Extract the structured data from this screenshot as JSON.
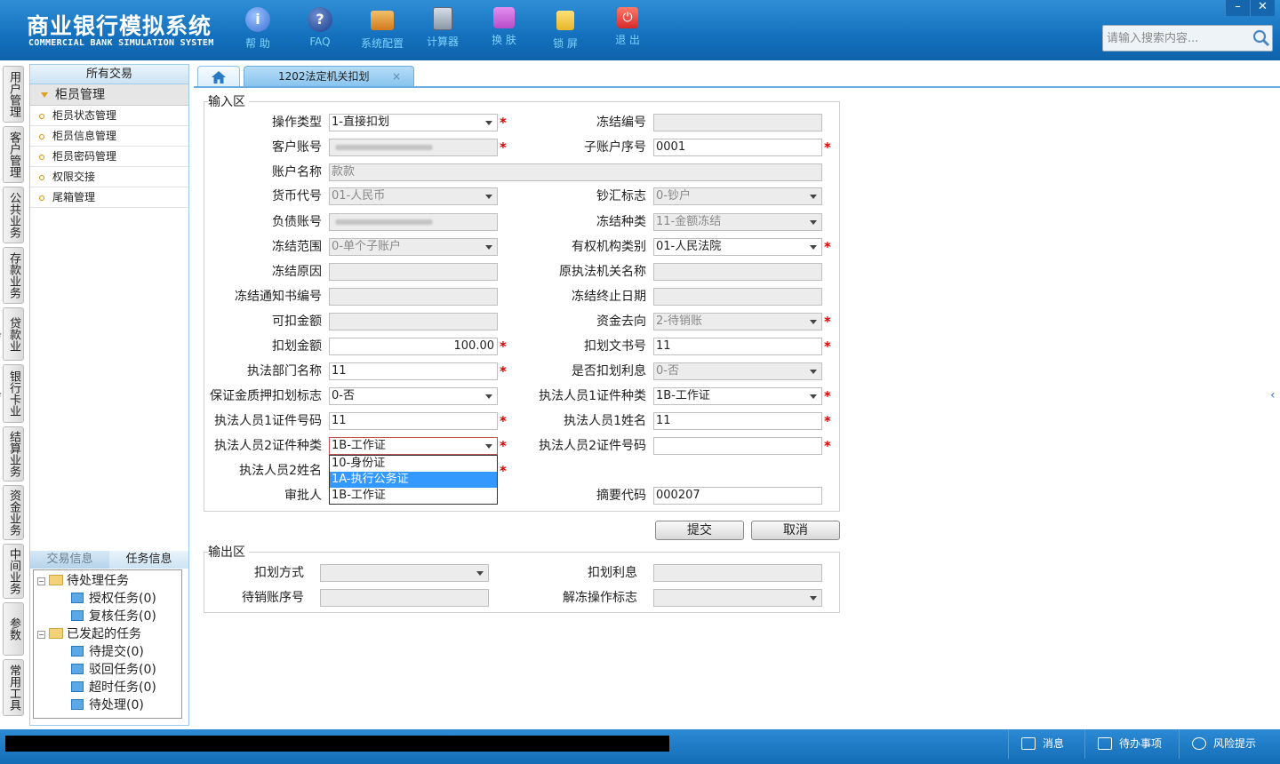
{
  "header": {
    "brand_cn": "商业银行模拟系统",
    "brand_en": "COMMERCIAL BANK SIMULATION SYSTEM",
    "toolbar": [
      {
        "label": "帮 助",
        "icon": "info-icon",
        "color": "#3a6fd1"
      },
      {
        "label": "FAQ",
        "icon": "question-icon",
        "color": "#1a3e8c"
      },
      {
        "label": "系统配置",
        "icon": "toolbox-icon",
        "color": "#e08a2a"
      },
      {
        "label": "计算器",
        "icon": "calculator-icon",
        "color": "#8a98a8"
      },
      {
        "label": "换 肤",
        "icon": "shirt-icon",
        "color": "#b84cc9"
      },
      {
        "label": "锁 屏",
        "icon": "lock-icon",
        "color": "#e8b52a"
      },
      {
        "label": "退 出",
        "icon": "power-icon",
        "color": "#d62a2a"
      }
    ],
    "window_buttons": [
      "–",
      "✕"
    ],
    "search_placeholder": "请输入搜索内容..."
  },
  "side_tabs": [
    "用户管理",
    "客户管理",
    "公共业务",
    "存款业务",
    "贷款业务",
    "银行卡业务",
    "结算业务",
    "资金业务",
    "中间业务",
    "参数",
    "常用工具"
  ],
  "nav": {
    "header": "所有交易",
    "group": "柜员管理",
    "items": [
      "柜员状态管理",
      "柜员信息管理",
      "柜员密码管理",
      "权限交接",
      "尾箱管理"
    ]
  },
  "task_panel": {
    "tabs": [
      "交易信息",
      "任务信息"
    ],
    "tree": {
      "pending": "待处理任务",
      "pending_children": [
        "授权任务(0)",
        "复核任务(0)"
      ],
      "initiated": "已发起的任务",
      "initiated_children": [
        "待提交(0)",
        "驳回任务(0)",
        "超时任务(0)",
        "待处理(0)"
      ]
    }
  },
  "doc_tab": {
    "title": "1202法定机关扣划",
    "close": "×"
  },
  "input_section": {
    "title": "输入区",
    "fields": {
      "op_type": {
        "label": "操作类型",
        "value": "1-直接扣划"
      },
      "freeze_no": {
        "label": "冻结编号",
        "value": ""
      },
      "cust_account": {
        "label": "客户账号",
        "value": ""
      },
      "sub_account_seq": {
        "label": "子账户序号",
        "value": "0001"
      },
      "account_name": {
        "label": "账户名称",
        "value": "款款"
      },
      "currency": {
        "label": "货币代号",
        "value": "01-人民币"
      },
      "cash_flag": {
        "label": "钞汇标志",
        "value": "0-钞户"
      },
      "debt_account": {
        "label": "负债账号",
        "value": ""
      },
      "freeze_kind": {
        "label": "冻结种类",
        "value": "11-金额冻结"
      },
      "freeze_scope": {
        "label": "冻结范围",
        "value": "0-单个子账户"
      },
      "authority_type": {
        "label": "有权机构类别",
        "value": "01-人民法院"
      },
      "freeze_reason": {
        "label": "冻结原因",
        "value": ""
      },
      "orig_authority": {
        "label": "原执法机关名称",
        "value": ""
      },
      "freeze_notice_no": {
        "label": "冻结通知书编号",
        "value": ""
      },
      "freeze_end_date": {
        "label": "冻结终止日期",
        "value": ""
      },
      "deductible_amount": {
        "label": "可扣金额",
        "value": ""
      },
      "fund_direction": {
        "label": "资金去向",
        "value": "2-待销账"
      },
      "deduct_amount": {
        "label": "扣划金额",
        "value": "100.00"
      },
      "deduct_doc_no": {
        "label": "扣划文书号",
        "value": "11"
      },
      "dept_name": {
        "label": "执法部门名称",
        "value": "11"
      },
      "deduct_interest_flag": {
        "label": "是否扣划利息",
        "value": "0-否"
      },
      "margin_flag": {
        "label": "保证金质押扣划标志",
        "value": "0-否"
      },
      "officer1_id_type": {
        "label": "执法人员1证件种类",
        "value": "1B-工作证"
      },
      "officer1_id_no": {
        "label": "执法人员1证件号码",
        "value": "11"
      },
      "officer1_name": {
        "label": "执法人员1姓名",
        "value": "11"
      },
      "officer2_id_type": {
        "label": "执法人员2证件种类",
        "value": "1B-工作证"
      },
      "officer2_id_no": {
        "label": "执法人员2证件号码",
        "value": ""
      },
      "officer2_name": {
        "label": "执法人员2姓名",
        "value": ""
      },
      "approver": {
        "label": "审批人",
        "value": ""
      },
      "summary_code": {
        "label": "摘要代码",
        "value": "000207"
      }
    },
    "dropdown_options": [
      "10-身份证",
      "1A-执行公务证",
      "1B-工作证"
    ],
    "dropdown_highlight_index": 1
  },
  "buttons": {
    "submit": "提交",
    "cancel": "取消"
  },
  "output_section": {
    "title": "输出区",
    "fields": {
      "deduct_method": {
        "label": "扣划方式",
        "value": ""
      },
      "deduct_interest": {
        "label": "扣划利息",
        "value": ""
      },
      "pending_seq": {
        "label": "待销账序号",
        "value": ""
      },
      "unfreeze_flag": {
        "label": "解冻操作标志",
        "value": ""
      }
    }
  },
  "status_bar": {
    "items": [
      {
        "label": "消息",
        "icon": "mail-icon"
      },
      {
        "label": "待办事项",
        "icon": "checkbox-icon"
      },
      {
        "label": "风险提示",
        "icon": "chat-icon"
      }
    ]
  }
}
